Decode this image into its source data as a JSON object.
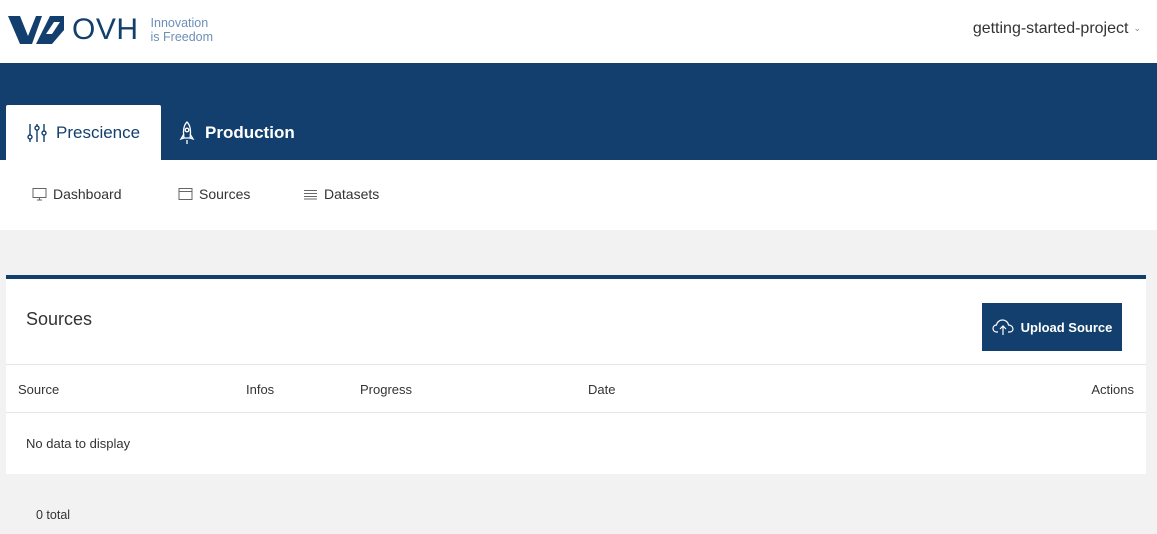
{
  "brand": {
    "name": "OVH",
    "tagline_line1": "Innovation",
    "tagline_line2": "is Freedom",
    "color": "#123f6d"
  },
  "header": {
    "project": "getting-started-project"
  },
  "tabs": [
    {
      "label": "Prescience",
      "icon": "sliders-icon",
      "active": true
    },
    {
      "label": "Production",
      "icon": "rocket-icon",
      "active": false
    }
  ],
  "subnav": [
    {
      "label": "Dashboard",
      "icon": "monitor-icon"
    },
    {
      "label": "Sources",
      "icon": "window-icon"
    },
    {
      "label": "Datasets",
      "icon": "list-icon"
    }
  ],
  "sources_panel": {
    "title": "Sources",
    "upload_label": "Upload Source",
    "columns": [
      "Source",
      "Infos",
      "Progress",
      "Date",
      "Actions"
    ],
    "empty_text": "No data to display",
    "total_text": "0 total"
  }
}
